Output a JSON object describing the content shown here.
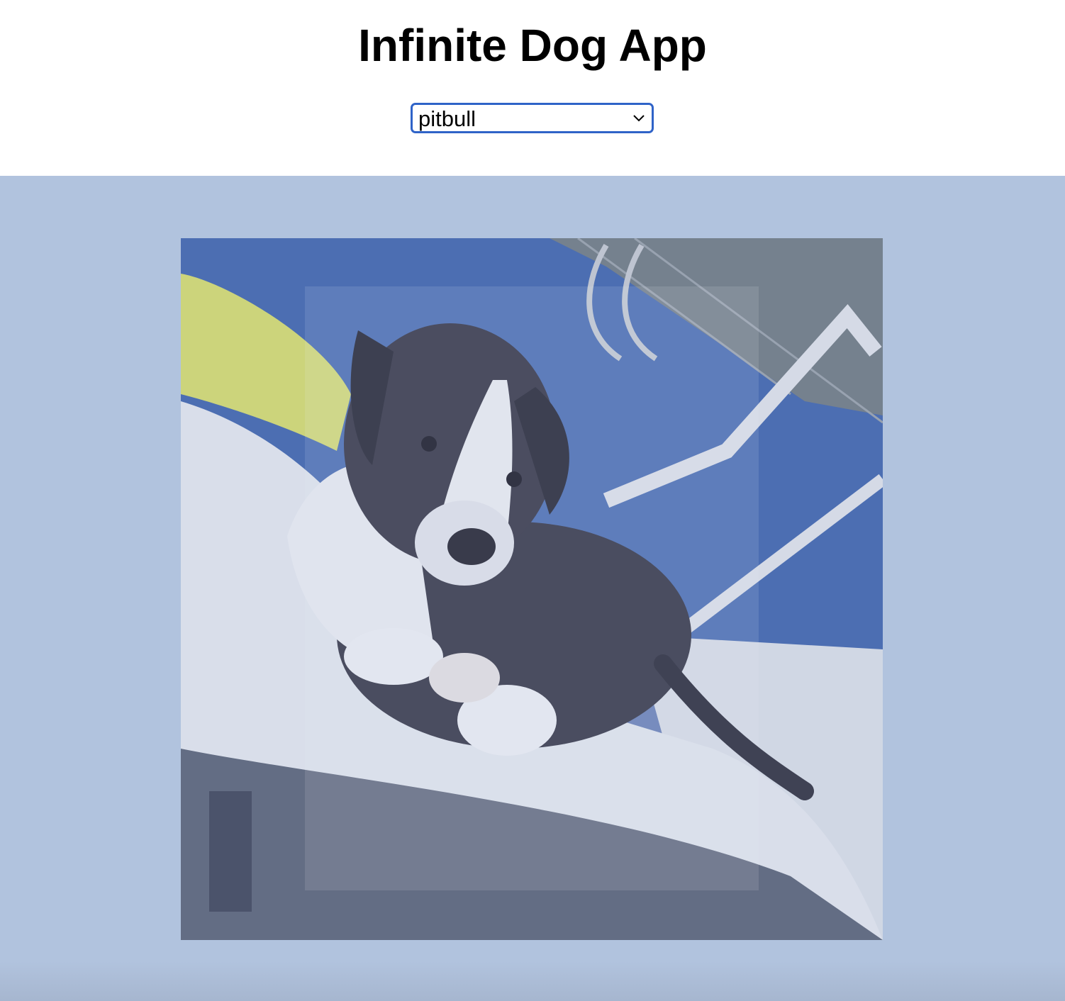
{
  "app": {
    "title": "Infinite Dog App"
  },
  "breed_select": {
    "selected": "pitbull",
    "icon": "chevron-down-icon"
  },
  "gallery": {
    "background_color": "#b1c3de",
    "image_alt": "pitbull"
  },
  "colors": {
    "select_border": "#2f63c8",
    "title_text": "#000000"
  }
}
